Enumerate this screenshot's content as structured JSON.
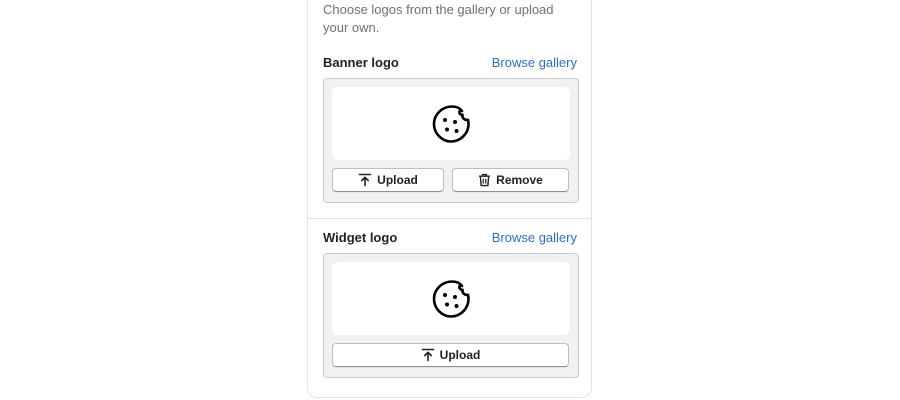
{
  "description": "Choose logos from the gallery or upload your own.",
  "banner": {
    "title": "Banner logo",
    "gallery_link": "Browse gallery",
    "upload_label": "Upload",
    "remove_label": "Remove",
    "preview_icon": "cookie-icon"
  },
  "widget": {
    "title": "Widget logo",
    "gallery_link": "Browse gallery",
    "upload_label": "Upload",
    "preview_icon": "cookie-icon"
  },
  "colors": {
    "link": "#2c6ecb",
    "text": "#202223",
    "muted": "#6d7175"
  }
}
